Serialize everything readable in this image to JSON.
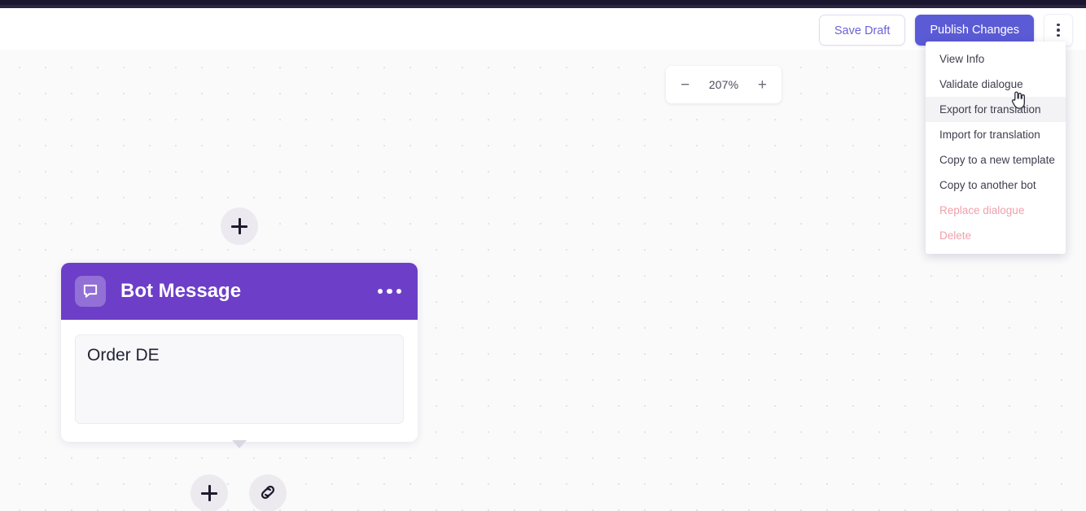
{
  "toolbar": {
    "save_draft_label": "Save Draft",
    "publish_label": "Publish Changes",
    "kebab_icon": "vertical-ellipsis-icon"
  },
  "dropdown": {
    "items": [
      {
        "label": "View Info",
        "state": "normal"
      },
      {
        "label": "Validate dialogue",
        "state": "normal"
      },
      {
        "label": "Export for translation",
        "state": "hovered"
      },
      {
        "label": "Import for translation",
        "state": "normal"
      },
      {
        "label": "Copy to a new template",
        "state": "normal"
      },
      {
        "label": "Copy to another bot",
        "state": "normal"
      },
      {
        "label": "Replace dialogue",
        "state": "danger"
      },
      {
        "label": "Delete",
        "state": "danger"
      }
    ]
  },
  "canvas": {
    "zoom": {
      "minus_label": "−",
      "value": "207%",
      "plus_label": "+"
    },
    "add_node_top_icon": "plus-icon",
    "add_node_bottom_icon": "plus-icon",
    "link_node_icon": "link-icon",
    "node": {
      "title": "Bot Message",
      "icon": "chat-bubble-icon",
      "menu_icon": "horizontal-ellipsis-icon",
      "message_text": "Order DE"
    }
  },
  "colors": {
    "brand_purple": "#5b5bd6",
    "node_header_purple": "#6d3fc8",
    "danger_pink": "#f0a0ab",
    "canvas_bg": "#fafafb",
    "top_strip": "#1b1630"
  }
}
